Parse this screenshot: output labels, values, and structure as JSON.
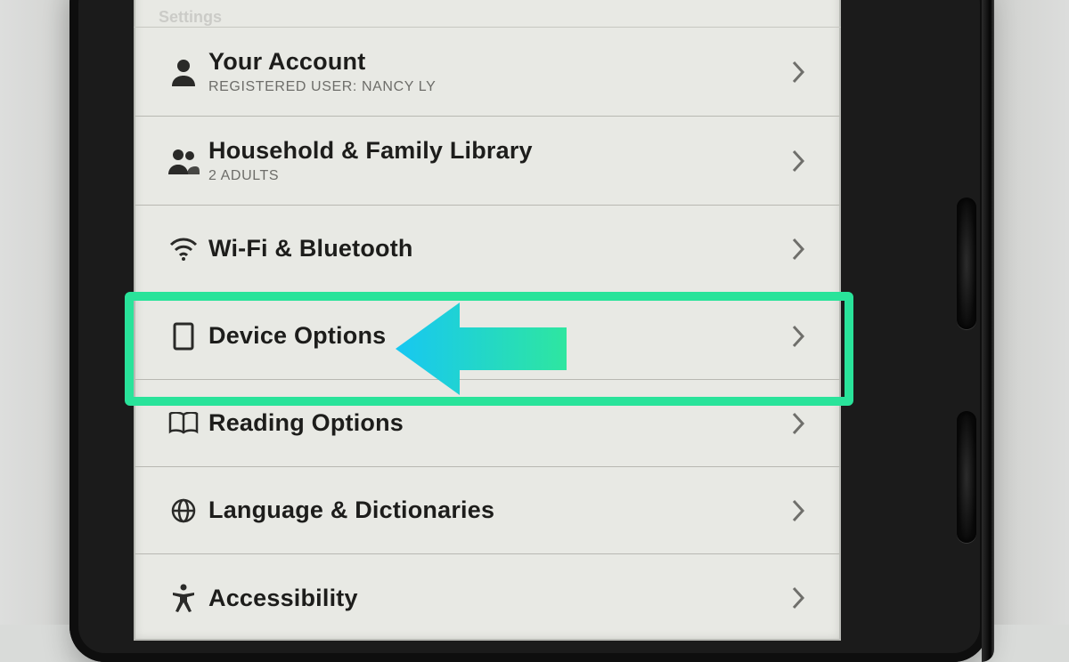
{
  "header": {
    "crumb": "Settings"
  },
  "rows": [
    {
      "icon": "person",
      "title": "Your Account",
      "sub": "REGISTERED USER: NANCY LY"
    },
    {
      "icon": "people",
      "title": "Household & Family Library",
      "sub": "2 ADULTS"
    },
    {
      "icon": "wifi",
      "title": "Wi-Fi & Bluetooth"
    },
    {
      "icon": "tablet",
      "title": "Device Options"
    },
    {
      "icon": "book",
      "title": "Reading Options"
    },
    {
      "icon": "globe",
      "title": "Language & Dictionaries"
    },
    {
      "icon": "a11y",
      "title": "Accessibility"
    }
  ],
  "annotation": {
    "highlight_index": 3,
    "highlight_box_color": "#29e39a",
    "arrow_gradient": [
      "#17c7f2",
      "#2ee6a0"
    ]
  }
}
